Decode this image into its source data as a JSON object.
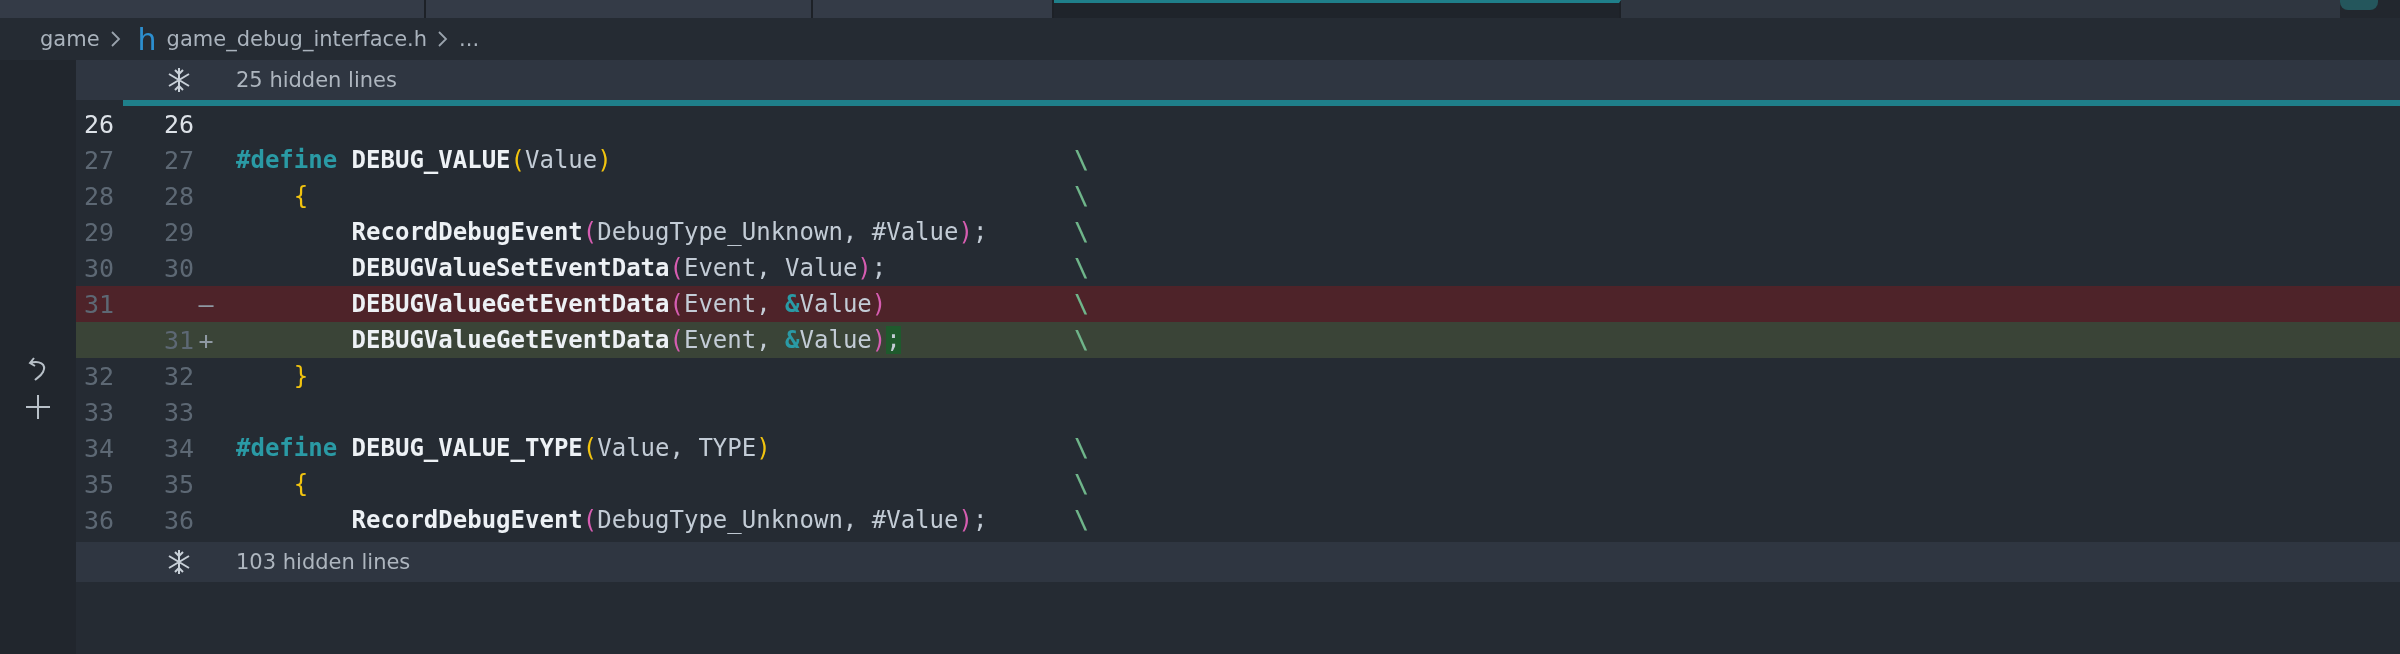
{
  "tabs": [
    {
      "selected": false
    },
    {
      "selected": false
    },
    {
      "selected": false
    },
    {
      "selected": true
    }
  ],
  "breadcrumb": {
    "items": [
      {
        "label": "game",
        "kind": "folder"
      },
      {
        "label": "game_debug_interface.h",
        "kind": "file",
        "icon": "h"
      },
      {
        "label": "...",
        "kind": "more"
      }
    ]
  },
  "hidden_top": {
    "label": "25 hidden lines"
  },
  "lines": [
    {
      "old": "26",
      "new": "26",
      "kind": "context",
      "current": true
    },
    {
      "old": "27",
      "new": "27",
      "kind": "context",
      "current": false,
      "tokens": [
        {
          "text": "#define",
          "kind": "keyword"
        },
        {
          "text": "DEBUG_VALUE",
          "kind": "func"
        },
        {
          "text": "(",
          "kind": "paren1"
        },
        {
          "text": "Value",
          "kind": "param"
        },
        {
          "text": ")",
          "kind": "paren1"
        }
      ],
      "cont": "\\"
    },
    {
      "old": "28",
      "new": "28",
      "kind": "context",
      "current": false,
      "tokens": [
        {
          "text": "    {",
          "kind": "paren1"
        }
      ],
      "cont": "\\"
    },
    {
      "old": "29",
      "new": "29",
      "kind": "context",
      "current": false,
      "tokens": [
        {
          "text": "        RecordDebugEvent",
          "kind": "func"
        },
        {
          "text": "(",
          "kind": "paren2"
        },
        {
          "text": "DebugType_Unknown, #Value",
          "kind": "param"
        },
        {
          "text": ")",
          "kind": "paren2"
        },
        {
          "text": ";",
          "kind": "param"
        }
      ],
      "cont": "\\"
    },
    {
      "old": "30",
      "new": "30",
      "kind": "context",
      "current": false,
      "tokens": [
        {
          "text": "        DEBUGValueSetEventData",
          "kind": "func"
        },
        {
          "text": "(",
          "kind": "paren2"
        },
        {
          "text": "Event, Value",
          "kind": "param"
        },
        {
          "text": ")",
          "kind": "paren2"
        },
        {
          "text": ";",
          "kind": "param"
        }
      ],
      "cont": "\\"
    },
    {
      "old": "31",
      "marker": "—",
      "kind": "removed",
      "current": false,
      "tokens": [
        {
          "text": "        DEBUGValueGetEventData",
          "kind": "func"
        },
        {
          "text": "(",
          "kind": "paren2"
        },
        {
          "text": "Event, ",
          "kind": "param"
        },
        {
          "text": "&",
          "kind": "amp"
        },
        {
          "text": "Value",
          "kind": "param"
        },
        {
          "text": ")",
          "kind": "paren2"
        }
      ],
      "cont": "\\"
    },
    {
      "new": "31",
      "marker": "+",
      "kind": "added",
      "current": false,
      "tokens": [
        {
          "text": "        DEBUGValueGetEventData",
          "kind": "func"
        },
        {
          "text": "(",
          "kind": "paren2"
        },
        {
          "text": "Event, ",
          "kind": "param"
        },
        {
          "text": "&",
          "kind": "amp"
        },
        {
          "text": "Value",
          "kind": "param"
        },
        {
          "text": ")",
          "kind": "paren2"
        },
        {
          "text": ";",
          "kind": "param",
          "changed": true
        }
      ],
      "cont": "\\"
    },
    {
      "old": "32",
      "new": "32",
      "kind": "context",
      "current": false,
      "tokens": [
        {
          "text": "    }",
          "kind": "paren1"
        }
      ]
    },
    {
      "old": "33",
      "new": "33",
      "kind": "context",
      "current": false
    },
    {
      "old": "34",
      "new": "34",
      "kind": "context",
      "current": false,
      "tokens": [
        {
          "text": "#define",
          "kind": "keyword"
        },
        {
          "text": "DEBUG_VALUE_TYPE",
          "kind": "func"
        },
        {
          "text": "(",
          "kind": "paren1"
        },
        {
          "text": "Value, TYPE",
          "kind": "param"
        },
        {
          "text": ")",
          "kind": "paren1"
        }
      ],
      "cont": "\\"
    },
    {
      "old": "35",
      "new": "35",
      "kind": "context",
      "current": false,
      "tokens": [
        {
          "text": "    {",
          "kind": "paren1"
        }
      ],
      "cont": "\\"
    },
    {
      "old": "36",
      "new": "36",
      "kind": "context",
      "current": false,
      "tokens": [
        {
          "text": "        RecordDebugEvent",
          "kind": "func"
        },
        {
          "text": "(",
          "kind": "paren2"
        },
        {
          "text": "DebugType_Unknown, #Value",
          "kind": "param"
        },
        {
          "text": ")",
          "kind": "paren2"
        },
        {
          "text": ";",
          "kind": "param"
        }
      ],
      "cont": "\\"
    }
  ],
  "hidden_bottom": {
    "label": "103 hidden lines"
  }
}
